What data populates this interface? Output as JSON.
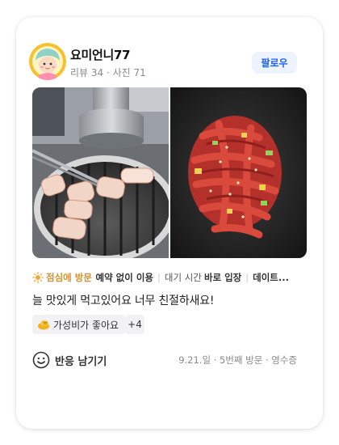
{
  "user": {
    "name": "요미언니77",
    "stats": "리뷰 34 · 사진 71",
    "follow_label": "팔로우"
  },
  "photos": [
    {
      "name": "photo-grill",
      "subject": "pork belly on grill"
    },
    {
      "name": "photo-marinated-meat",
      "subject": "marinated meat"
    }
  ],
  "tags": [
    {
      "text": "점심에 방문",
      "style": "highlight"
    },
    {
      "text": "예약 없이 이용",
      "style": "bold"
    },
    {
      "text": "대기 시간",
      "style": "normal"
    },
    {
      "text": "바로 입장",
      "style": "bold"
    },
    {
      "text": "데이트...",
      "style": "bold"
    }
  ],
  "review": {
    "text": "늘 맛있게 먹고있어요 너무 친절하새요!"
  },
  "keyword": {
    "label": "가성비가 좋아요",
    "more": "+4"
  },
  "reaction": {
    "label": "반응 남기기"
  },
  "visit_info": "9.21.일 · 5번째 방문 · 영수증",
  "colors": {
    "accent_blue": "#1f62f2",
    "follow_bg": "#eef4ff",
    "highlight": "#d4922c",
    "muted": "#8a8a8a",
    "chip_bg": "#f2f2f4"
  },
  "icons": {
    "avatar": "profile-character-icon",
    "visit_time": "sun-icon",
    "keyword": "money-icon",
    "reaction": "smile-icon"
  }
}
